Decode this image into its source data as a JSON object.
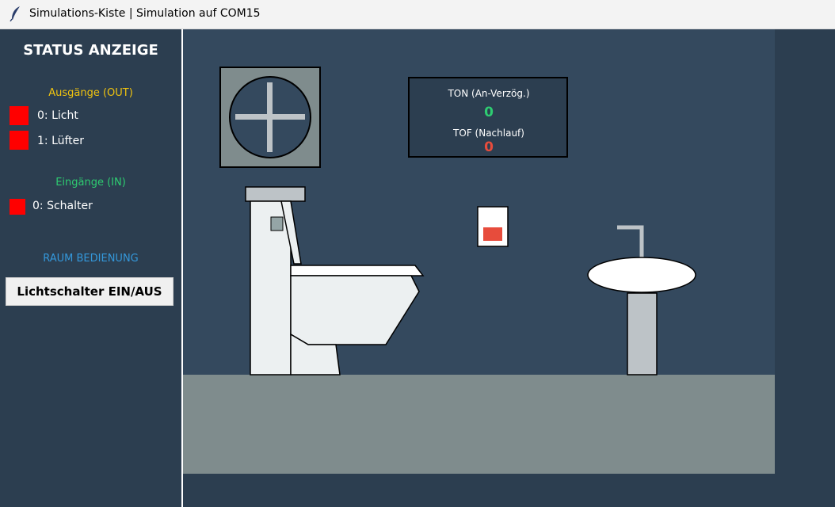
{
  "window": {
    "title": "Simulations-Kiste | Simulation auf COM15",
    "icon": "feather-icon"
  },
  "sidebar": {
    "title": "STATUS ANZEIGE",
    "outputs_title": "Ausgänge (OUT)",
    "outputs": [
      {
        "label": "0: Licht",
        "state": "off"
      },
      {
        "label": "1: Lüfter",
        "state": "off"
      }
    ],
    "inputs_title": "Eingänge (IN)",
    "inputs": [
      {
        "label": "0: Schalter",
        "state": "off"
      }
    ],
    "controls_title": "RAUM BEDIENUNG",
    "light_switch_button": "Lichtschalter EIN/AUS"
  },
  "timer_panel": {
    "ton_label": "TON (An-Verzög.)",
    "ton_value": "0",
    "tof_label": "TOF (Nachlauf)",
    "tof_value": "0"
  },
  "colors": {
    "background": "#2c3e50",
    "room_wall": "#34495e",
    "floor": "#7f8c8d",
    "led_off": "#ff0000",
    "outputs_title": "#f1c40f",
    "inputs_title": "#2ecc71",
    "controls_title": "#3498db",
    "ton_value": "#2ecc71",
    "tof_value": "#e74c3c",
    "switch_indicator": "#e74c3c"
  }
}
